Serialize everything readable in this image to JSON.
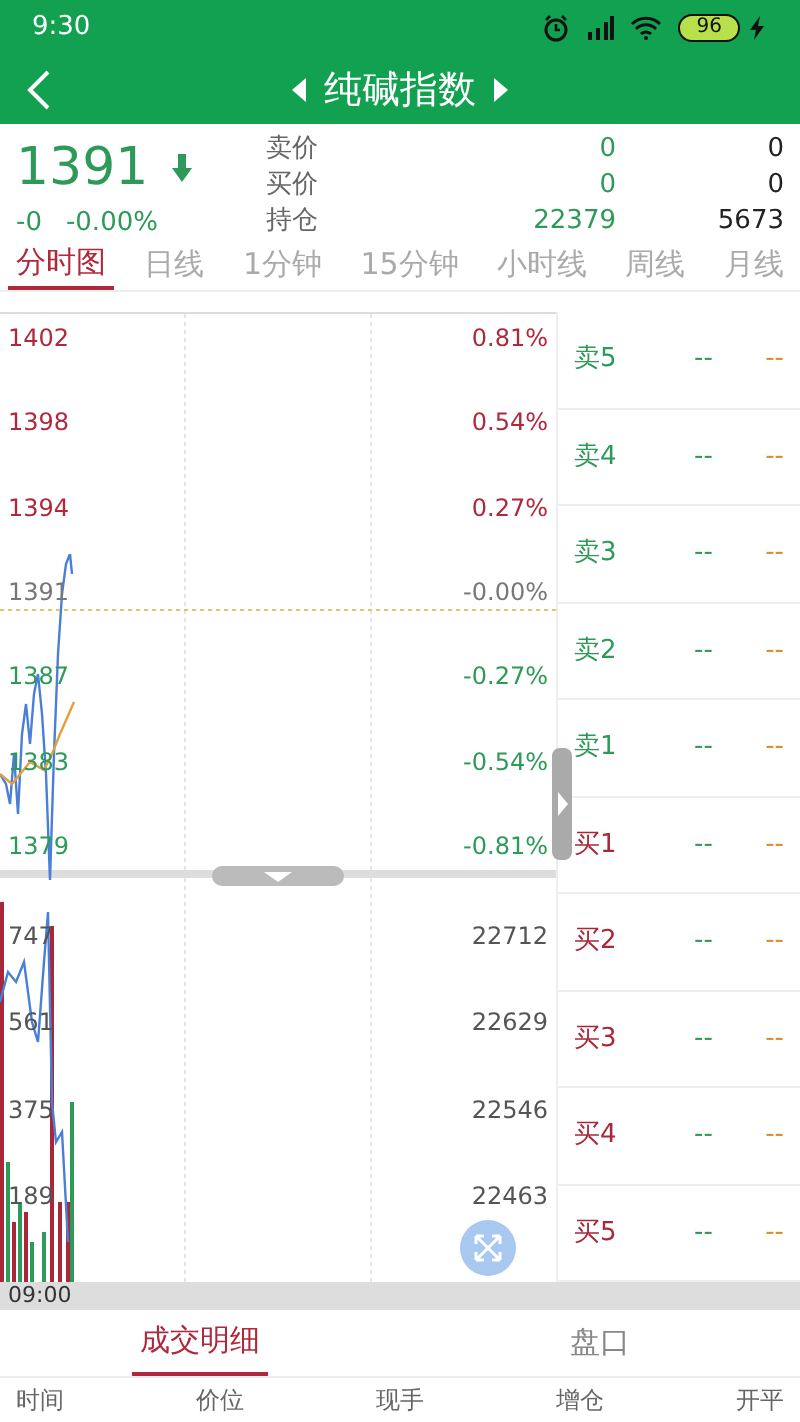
{
  "status_bar": {
    "time": "9:30",
    "battery": "96"
  },
  "header": {
    "title": "纯碱指数"
  },
  "quote": {
    "price": "1391",
    "change": "-0",
    "change_pct": "-0.00%",
    "falling": true,
    "rows": [
      {
        "label": "卖价",
        "value": "0",
        "value_2": "0"
      },
      {
        "label": "买价",
        "value": "0",
        "value_2": "0"
      },
      {
        "label": "持仓",
        "value": "22379",
        "value_2": "5673"
      }
    ]
  },
  "tabs": [
    {
      "label": "分时图",
      "selected": true
    },
    {
      "label": "日线",
      "selected": false
    },
    {
      "label": "1分钟",
      "selected": false
    },
    {
      "label": "15分钟",
      "selected": false
    },
    {
      "label": "小时线",
      "selected": false
    },
    {
      "label": "周线",
      "selected": false
    },
    {
      "label": "月线",
      "selected": false
    }
  ],
  "price_axis": [
    {
      "price": "1402",
      "pct": "0.81%",
      "color": "#b0283c"
    },
    {
      "price": "1398",
      "pct": "0.54%",
      "color": "#b0283c"
    },
    {
      "price": "1394",
      "pct": "0.27%",
      "color": "#b0283c"
    },
    {
      "price": "1391",
      "pct": "-0.00%",
      "color": "#777777"
    },
    {
      "price": "1387",
      "pct": "-0.27%",
      "color": "#2e9a5a"
    },
    {
      "price": "1383",
      "pct": "-0.54%",
      "color": "#2e9a5a"
    },
    {
      "price": "1379",
      "pct": "-0.81%",
      "color": "#2e9a5a"
    }
  ],
  "volume_axis": [
    {
      "volume": "747",
      "open_interest": "22712"
    },
    {
      "volume": "561",
      "open_interest": "22629"
    },
    {
      "volume": "375",
      "open_interest": "22546"
    },
    {
      "volume": "189",
      "open_interest": "22463"
    }
  ],
  "time_label": "09:00",
  "order_book": [
    {
      "label": "卖5",
      "color": "#2e9a5a",
      "price": "--",
      "volume": "--"
    },
    {
      "label": "卖4",
      "color": "#2e9a5a",
      "price": "--",
      "volume": "--"
    },
    {
      "label": "卖3",
      "color": "#2e9a5a",
      "price": "--",
      "volume": "--"
    },
    {
      "label": "卖2",
      "color": "#2e9a5a",
      "price": "--",
      "volume": "--"
    },
    {
      "label": "卖1",
      "color": "#2e9a5a",
      "price": "--",
      "volume": "--"
    },
    {
      "label": "买1",
      "color": "#a8283a",
      "price": "--",
      "volume": "--"
    },
    {
      "label": "买2",
      "color": "#a8283a",
      "price": "--",
      "volume": "--"
    },
    {
      "label": "买3",
      "color": "#a8283a",
      "price": "--",
      "volume": "--"
    },
    {
      "label": "买4",
      "color": "#a8283a",
      "price": "--",
      "volume": "--"
    },
    {
      "label": "买5",
      "color": "#a8283a",
      "price": "--",
      "volume": "--"
    }
  ],
  "bottom_tabs": [
    {
      "label": "成交明细",
      "selected": true
    },
    {
      "label": "盘口",
      "selected": false
    }
  ],
  "table_columns": [
    "时间",
    "价位",
    "现手",
    "增仓",
    "开平"
  ]
}
